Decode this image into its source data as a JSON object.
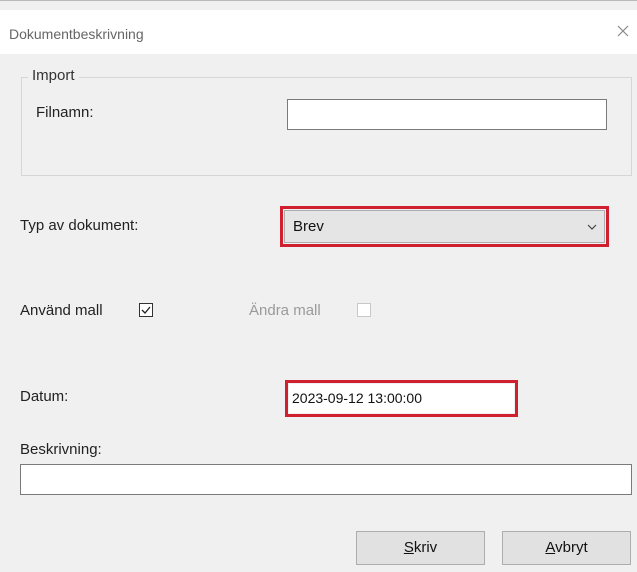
{
  "window": {
    "title": "Dokumentbeskrivning",
    "close_icon": "close-icon"
  },
  "import_group": {
    "label": "Import",
    "filename_label": "Filnamn:",
    "filename_value": ""
  },
  "document_type": {
    "label": "Typ av dokument:",
    "selected": "Brev",
    "dropdown_icon": "chevron-down-icon"
  },
  "template": {
    "use_label": "Använd mall",
    "use_checked": true,
    "change_label": "Ändra mall",
    "change_checked": false,
    "change_enabled": false
  },
  "date": {
    "label": "Datum:",
    "value": "2023-09-12 13:00:00"
  },
  "description": {
    "label": "Beskrivning:",
    "value": ""
  },
  "buttons": {
    "write_mnemonic": "S",
    "write_rest": "kriv",
    "cancel_mnemonic": "A",
    "cancel_rest": "vbryt"
  },
  "colors": {
    "highlight": "#d0202f",
    "dialog_bg": "#f0f0f0",
    "title_bg": "#ffffff"
  }
}
